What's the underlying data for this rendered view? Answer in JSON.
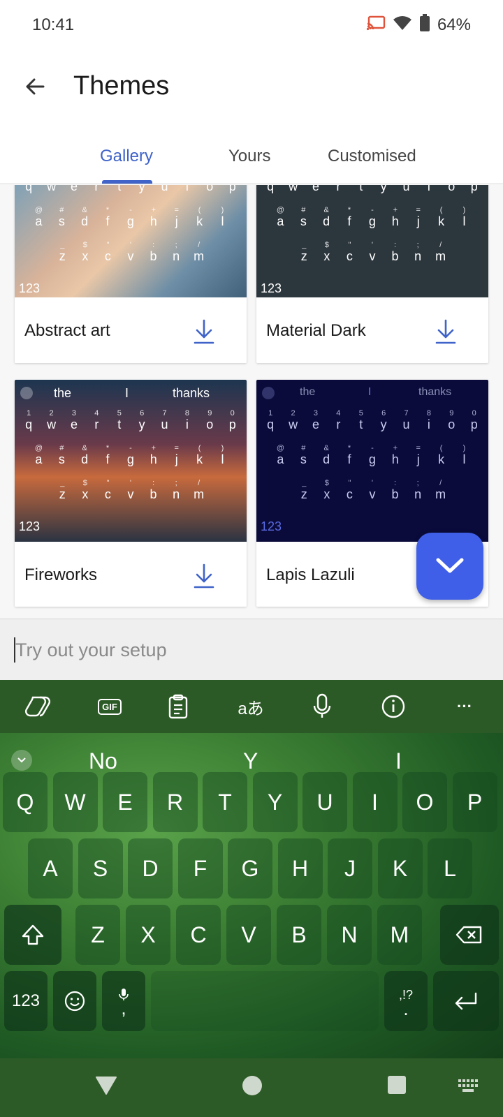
{
  "status": {
    "time": "10:41",
    "battery": "64%"
  },
  "header": {
    "title": "Themes"
  },
  "tabs": [
    {
      "label": "Gallery",
      "active": true
    },
    {
      "label": "Yours",
      "active": false
    },
    {
      "label": "Customised",
      "active": false
    }
  ],
  "themes": [
    {
      "name": "Abstract art"
    },
    {
      "name": "Material Dark"
    },
    {
      "name": "Fireworks",
      "suggestions": [
        "the",
        "I",
        "thanks"
      ]
    },
    {
      "name": "Lapis Lazuli",
      "suggestions": [
        "the",
        "I",
        "thanks"
      ]
    }
  ],
  "mini_keys": {
    "row1": [
      "q",
      "w",
      "e",
      "r",
      "t",
      "y",
      "u",
      "i",
      "o",
      "p"
    ],
    "row1_sup": [
      "1",
      "2",
      "3",
      "4",
      "5",
      "6",
      "7",
      "8",
      "9",
      "0"
    ],
    "row2": [
      "a",
      "s",
      "d",
      "f",
      "g",
      "h",
      "j",
      "k",
      "l"
    ],
    "row2_sup": [
      "@",
      "#",
      "&",
      "*",
      "-",
      "+",
      "=",
      "(",
      ")"
    ],
    "row3": [
      "z",
      "x",
      "c",
      "v",
      "b",
      "n",
      "m"
    ],
    "row3_sup": [
      "_",
      "$",
      "\"",
      "'",
      ":",
      ";",
      "/"
    ],
    "num_label": "123",
    "punct_label": ".",
    "punct_sup": ",!?",
    "comma": ","
  },
  "try_input": {
    "placeholder": "Try out your setup",
    "value": ""
  },
  "keyboard": {
    "toolbar_icons": [
      "copilot-icon",
      "gif-icon",
      "clipboard-icon",
      "translate-icon",
      "mic-icon",
      "info-icon",
      "more-icon"
    ],
    "gif_label": "GIF",
    "translate_label": "aあ",
    "more_label": "···",
    "suggestions": [
      "No",
      "Y",
      "I"
    ],
    "row1": [
      "Q",
      "W",
      "E",
      "R",
      "T",
      "Y",
      "U",
      "I",
      "O",
      "P"
    ],
    "row2": [
      "A",
      "S",
      "D",
      "F",
      "G",
      "H",
      "J",
      "K",
      "L"
    ],
    "row3": [
      "Z",
      "X",
      "C",
      "V",
      "B",
      "N",
      "M"
    ],
    "num_label": "123",
    "comma_label": ",",
    "punct_label": ".",
    "punct_sup": ",!?"
  },
  "colors": {
    "accent": "#3f63c9",
    "fab": "#3f5fe8",
    "keyboard_toolbar": "#2c5a26",
    "navbar": "#2d5b27"
  }
}
